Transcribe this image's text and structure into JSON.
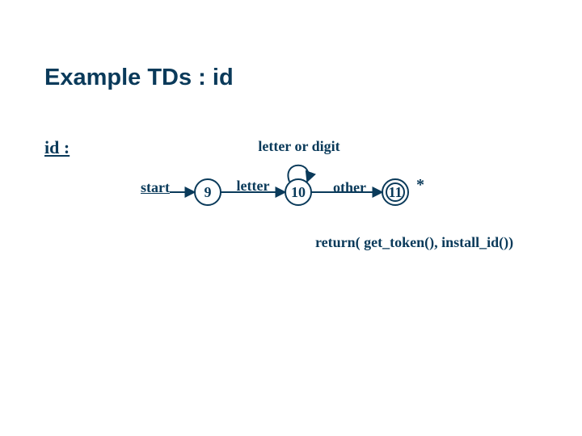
{
  "title": "Example TDs : id",
  "lhs": "id :",
  "edges": {
    "start": "start",
    "letter": "letter",
    "letter_or_digit": "letter or digit",
    "other": "other"
  },
  "states": {
    "s9": "9",
    "s10": "10",
    "s11": "11"
  },
  "retract_mark": "*",
  "action": "return( get_token(), install_id())",
  "chart_data": {
    "type": "transition-diagram",
    "name": "id",
    "start_edge_label": "start",
    "states": [
      {
        "id": 9,
        "accepting": false
      },
      {
        "id": 10,
        "accepting": false
      },
      {
        "id": 11,
        "accepting": true,
        "retract": true,
        "action": "return( get_token(), install_id())"
      }
    ],
    "transitions": [
      {
        "from": 9,
        "to": 10,
        "label": "letter"
      },
      {
        "from": 10,
        "to": 10,
        "label": "letter or digit"
      },
      {
        "from": 10,
        "to": 11,
        "label": "other"
      }
    ]
  }
}
